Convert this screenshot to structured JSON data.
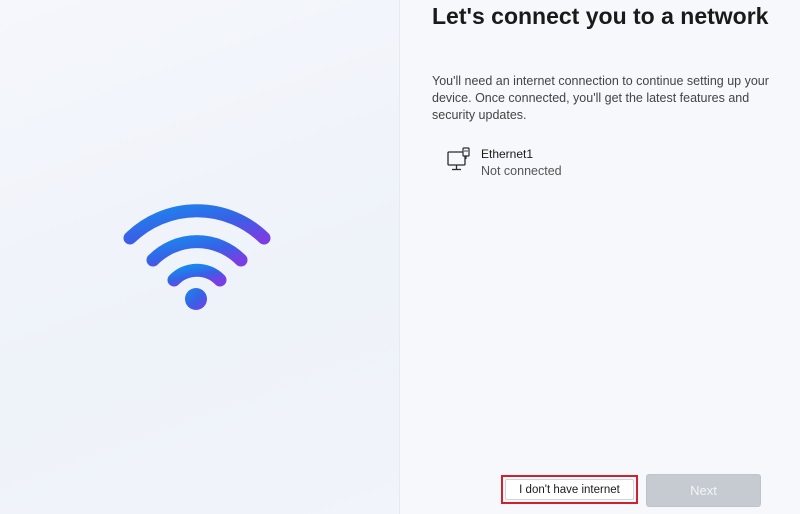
{
  "setup": {
    "title": "Let's connect you to a network",
    "description": "You'll need an internet connection to continue setting up your device. Once connected, you'll get the latest features and security updates.",
    "networks": [
      {
        "name": "Ethernet1",
        "status": "Not connected",
        "icon": "ethernet-icon"
      }
    ],
    "illustration_icon": "wifi-icon",
    "no_internet_label": "I don't have internet",
    "next_label": "Next"
  },
  "colors": {
    "wifi_gradient_start": "#1f7be8",
    "wifi_gradient_end": "#7b3fe4",
    "highlight_border": "#d0222e",
    "next_disabled_bg": "#c6cad1"
  }
}
